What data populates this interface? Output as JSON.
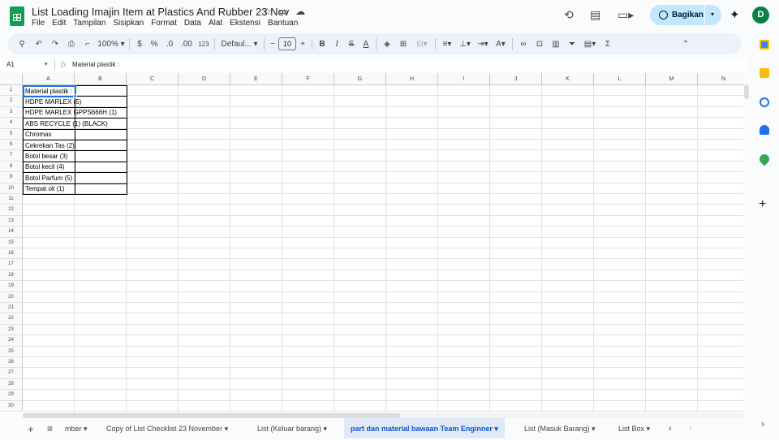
{
  "doc": {
    "title": "List Loading Imajin Item at Plastics And Rubber 23 Nov",
    "menus": [
      "File",
      "Edit",
      "Tampilan",
      "Sisipkan",
      "Format",
      "Data",
      "Alat",
      "Ekstensi",
      "Bantuan"
    ],
    "share_label": "Bagikan",
    "avatar_letter": "D"
  },
  "toolbar": {
    "zoom": "100%",
    "currency": "$",
    "percent": "%",
    "decrease_decimal": ".0",
    "increase_decimal": ".00",
    "number_format": "123",
    "font": "Defaul...",
    "font_size": "10",
    "bold": "B",
    "italic": "I",
    "strike": "S",
    "text_color": "A"
  },
  "formula_bar": {
    "cell_ref": "A1",
    "fx": "fx",
    "value": "Material plastik :"
  },
  "columns": [
    "A",
    "B",
    "C",
    "D",
    "E",
    "F",
    "G",
    "H",
    "I",
    "J",
    "K",
    "L",
    "M",
    "N"
  ],
  "rows": [
    "1",
    "2",
    "3",
    "4",
    "5",
    "6",
    "7",
    "8",
    "9",
    "10",
    "11",
    "12",
    "13",
    "14",
    "15",
    "16",
    "17",
    "18",
    "19",
    "20",
    "21",
    "22",
    "23",
    "24",
    "25",
    "26",
    "27",
    "28",
    "29",
    "30"
  ],
  "cells": {
    "a1": "Material plastik :",
    "a2": "HDPE MARLEX  (5)",
    "a3": "HDPE MARLEX GPPS666H (1)",
    "a4": "ABS RECYCLE (1) (BLACK)",
    "a5": "Chromax",
    "a6": "Cekrekan Tas (2)",
    "a7": "Botol besar (3)",
    "a8": "Botol kecil (4)",
    "a9": "Botol Parfum (5)",
    "a10": "Tempat oli (1)"
  },
  "sheet_tabs": {
    "add": "+",
    "list": "≡",
    "tab1": "mber",
    "tab2": "Copy of List Checklist 23 November",
    "tab3": "List (Keluar barang)",
    "tab4": "part dan material bawaan Team Enginner",
    "tab5": "List (Masuk Barang)",
    "tab6": "List Box"
  },
  "colors": {
    "accent": "#1a73e8",
    "share_bg": "#c2e7ff",
    "sheets_green": "#0f9d58",
    "active_tab": "#0b57d0"
  }
}
